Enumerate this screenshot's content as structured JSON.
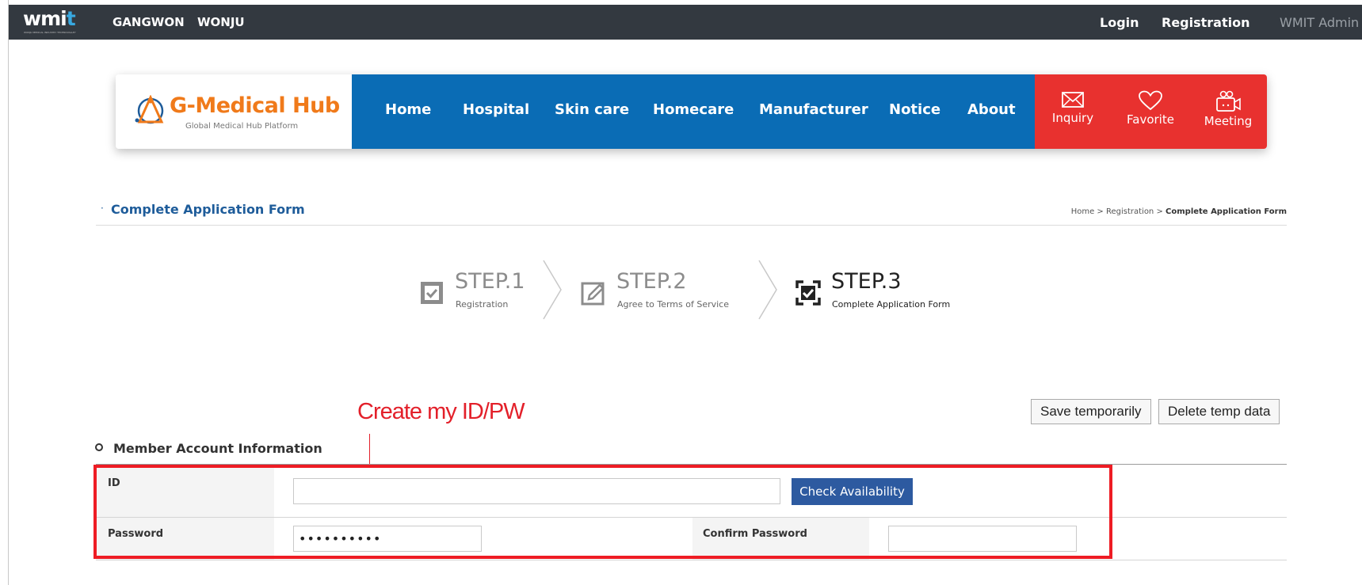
{
  "topbar": {
    "logo_main": "wmi",
    "logo_accent": "t",
    "logo_sub": "WONJU MEDICAL INDUSTRY TECHNOVALLEY",
    "city1": "GANGWON",
    "city2": "WONJU",
    "login": "Login",
    "registration": "Registration",
    "admin": "WMIT Admin"
  },
  "brand": {
    "title": "G-Medical Hub",
    "subtitle": "Global Medical Hub Platform"
  },
  "nav": {
    "items": [
      "Home",
      "Hospital",
      "Skin care",
      "Homecare",
      "Manufacturer",
      "Notice",
      "About"
    ]
  },
  "quick": {
    "inquiry": "Inquiry",
    "favorite": "Favorite",
    "meeting": "Meeting"
  },
  "page": {
    "bullet": "·",
    "title": "Complete Application Form",
    "crumb_home": "Home",
    "crumb_sep1": " > ",
    "crumb_reg": "Registration",
    "crumb_sep2": " > ",
    "crumb_current": "Complete Application Form"
  },
  "steps": [
    {
      "title": "STEP.1",
      "sub": "Registration"
    },
    {
      "title": "STEP.2",
      "sub": "Agree to Terms of Service"
    },
    {
      "title": "STEP.3",
      "sub": "Complete Application Form"
    }
  ],
  "actions": {
    "save_temp": "Save temporarily",
    "delete_temp": "Delete temp data"
  },
  "annotation": {
    "label": "Create my ID/PW"
  },
  "account": {
    "section_title": "Member Account Information",
    "id_label": "ID",
    "id_value": "",
    "check_button": "Check Availability",
    "password_label": "Password",
    "password_value": "••••••••••",
    "confirm_label": "Confirm Password",
    "confirm_value": ""
  },
  "colors": {
    "topbar": "#333940",
    "nav_blue": "#0a6cb5",
    "quick_red": "#e8312f",
    "brand_orange": "#f07a1a",
    "title_blue": "#1e5c9a",
    "check_button": "#2d5aa0",
    "annotation_red": "#ee1c24"
  }
}
